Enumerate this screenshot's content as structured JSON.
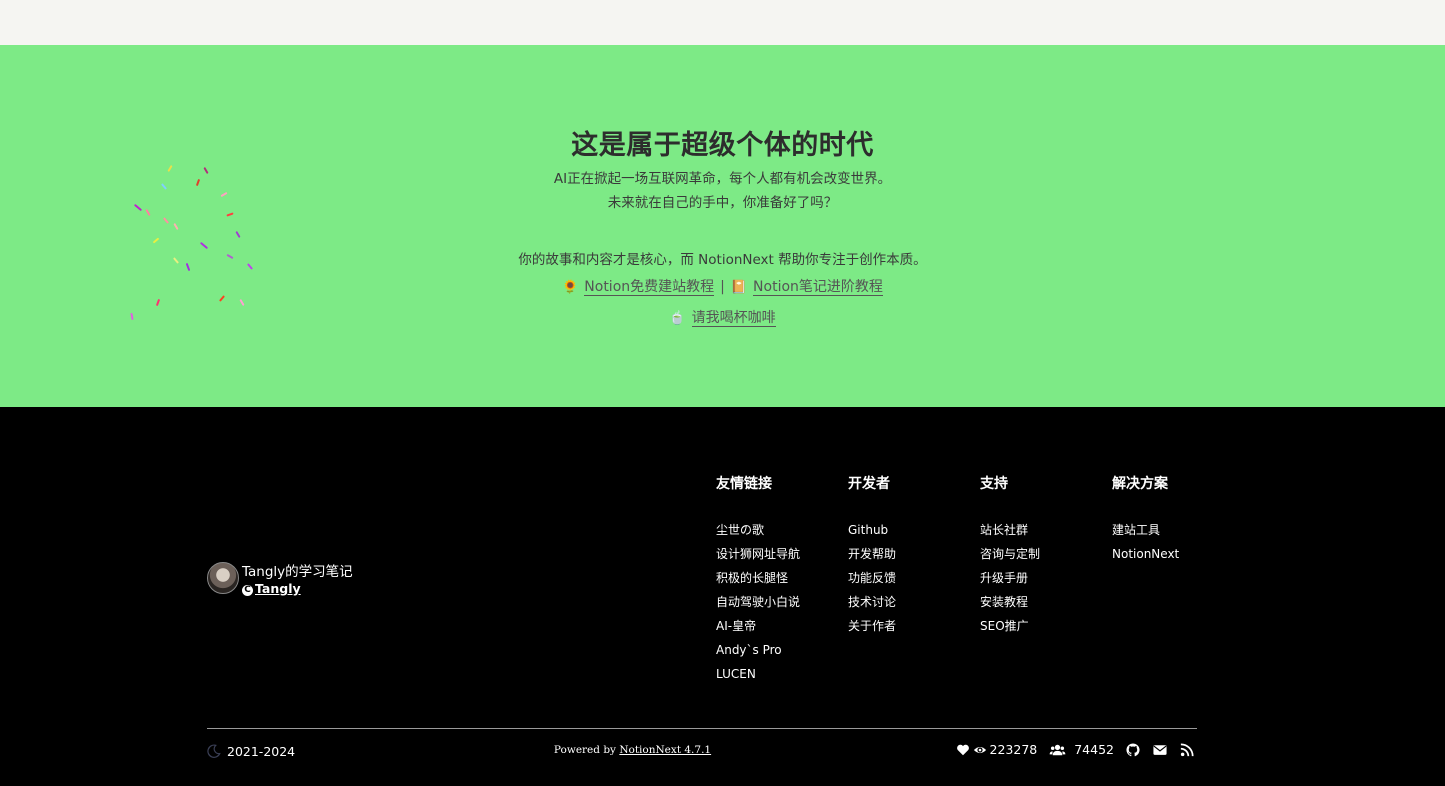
{
  "hero": {
    "title": "这是属于超级个体的时代",
    "line1": "AI正在掀起一场互联网革命，每个人都有机会改变世界。",
    "line2": "未来就在自己的手中，你准备好了吗？",
    "line3": "你的故事和内容才是核心，而 NotionNext 帮助你专注于创作本质。",
    "link1_emoji": "🌻",
    "link1": "Notion免费建站教程",
    "separator": "|",
    "link2_emoji": "📔",
    "link2": "Notion笔记进阶教程",
    "coffee_emoji": "🍵",
    "coffee_link": "请我喝杯咖啡",
    "bg_color": "#7dea86"
  },
  "footer": {
    "brand_title": "Tangly的学习笔记",
    "copyright_symbol": "C",
    "author": "Tangly",
    "columns": [
      {
        "title": "友情链接",
        "items": [
          "尘世の歌",
          "设计狮网址导航",
          "积极的长腿怪",
          "自动驾驶小白说",
          "AI-皇帝",
          "Andy`s Pro",
          "LUCEN"
        ]
      },
      {
        "title": "开发者",
        "items": [
          "Github",
          "开发帮助",
          "功能反馈",
          "技术讨论",
          "关于作者"
        ]
      },
      {
        "title": "支持",
        "items": [
          "站长社群",
          "咨询与定制",
          "升级手册",
          "安装教程",
          "SEO推广"
        ]
      },
      {
        "title": "解决方案",
        "items": [
          "建站工具",
          "NotionNext"
        ]
      }
    ],
    "years": "2021-2024",
    "powered_prefix": "Powered by ",
    "powered_link": "NotionNext 4.7.1",
    "views": "223278",
    "visitors": "74452"
  }
}
